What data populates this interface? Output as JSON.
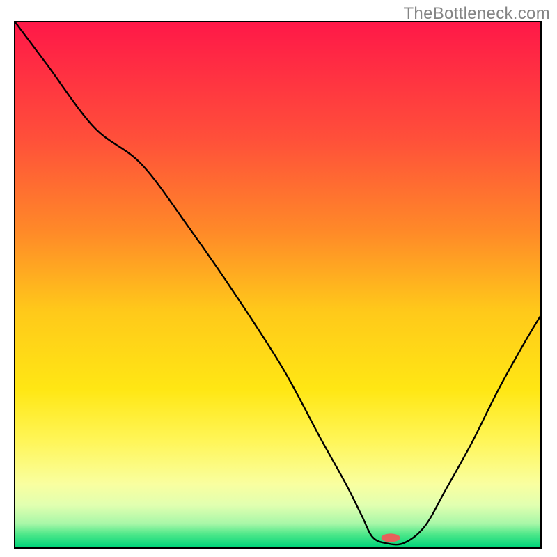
{
  "watermark": "TheBottleneck.com",
  "chart_data": {
    "type": "line",
    "title": "",
    "xlabel": "",
    "ylabel": "",
    "xlim": [
      0,
      100
    ],
    "ylim": [
      0,
      100
    ],
    "legend": false,
    "grid": false,
    "annotations": [],
    "gradient_stops": [
      {
        "offset": 0.0,
        "color": "#ff1848"
      },
      {
        "offset": 0.22,
        "color": "#ff4f3a"
      },
      {
        "offset": 0.4,
        "color": "#ff8a28"
      },
      {
        "offset": 0.55,
        "color": "#ffc91a"
      },
      {
        "offset": 0.7,
        "color": "#ffe714"
      },
      {
        "offset": 0.8,
        "color": "#fff65a"
      },
      {
        "offset": 0.88,
        "color": "#f9ffa0"
      },
      {
        "offset": 0.92,
        "color": "#e1ffb0"
      },
      {
        "offset": 0.955,
        "color": "#a8f7a8"
      },
      {
        "offset": 0.975,
        "color": "#4fe88a"
      },
      {
        "offset": 1.0,
        "color": "#00d47a"
      }
    ],
    "series": [
      {
        "name": "curve",
        "x": [
          0.0,
          6.0,
          15.0,
          24.0,
          33.0,
          42.0,
          51.0,
          58.0,
          63.0,
          66.0,
          68.0,
          70.5,
          74.0,
          78.0,
          82.0,
          87.0,
          92.0,
          97.0,
          100.0
        ],
        "values": [
          100.0,
          92.0,
          80.0,
          73.0,
          61.0,
          48.0,
          34.0,
          21.0,
          12.0,
          6.0,
          2.0,
          0.8,
          0.8,
          4.0,
          11.0,
          20.0,
          30.0,
          39.0,
          44.0
        ]
      }
    ],
    "marker": {
      "x": 71.5,
      "y": 1.8,
      "color": "#e7605b",
      "rx": 1.8,
      "ry": 0.8
    }
  }
}
